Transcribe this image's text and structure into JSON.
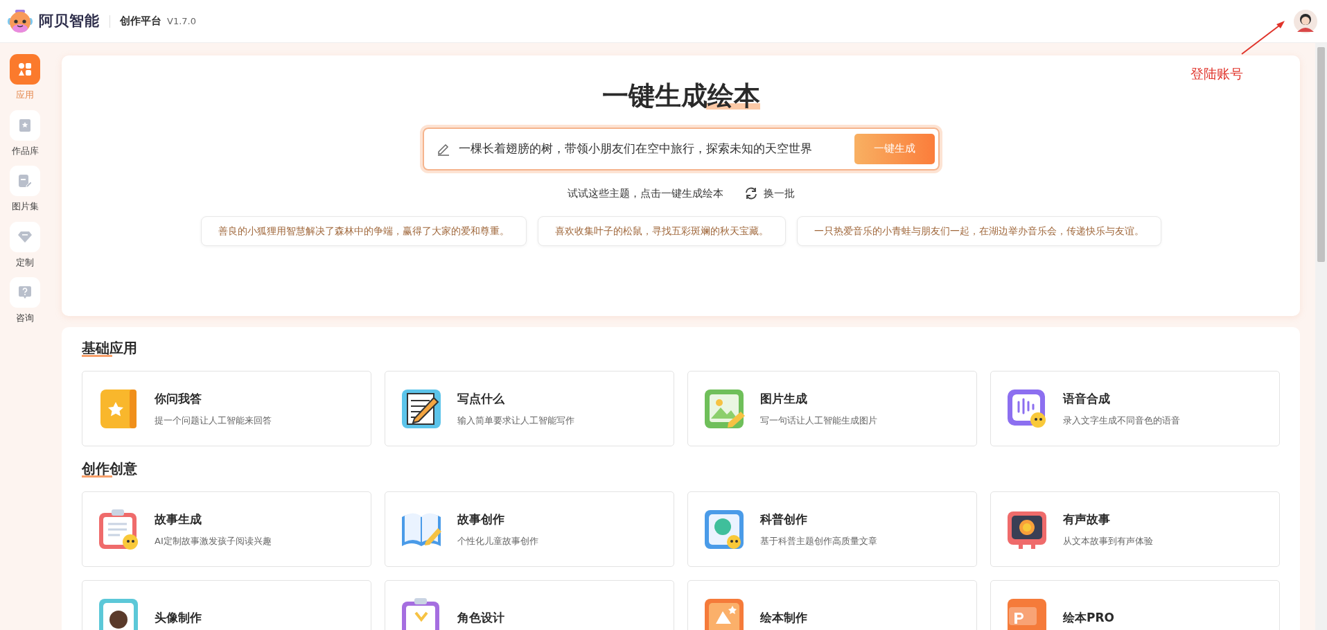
{
  "header": {
    "brand": "阿贝智能",
    "product": "创作平台",
    "version": "V1.7.0"
  },
  "annotation": {
    "text": "登陆账号"
  },
  "sidebar": {
    "items": [
      {
        "label": "应用",
        "selected": true
      },
      {
        "label": "作品库",
        "selected": false
      },
      {
        "label": "图片集",
        "selected": false
      },
      {
        "label": "定制",
        "selected": false
      },
      {
        "label": "咨询",
        "selected": false
      }
    ]
  },
  "hero": {
    "title": "一键生成绘本",
    "input_value": "一棵长着翅膀的树，带领小朋友们在空中旅行，探索未知的天空世界",
    "button": "一键生成",
    "hint": "试试这些主题，点击一键生成绘本",
    "refresh": "换一批",
    "suggestions": [
      "善良的小狐狸用智慧解决了森林中的争端，赢得了大家的爱和尊重。",
      "喜欢收集叶子的松鼠，寻找五彩斑斓的秋天宝藏。",
      "一只热爱音乐的小青蛙与朋友们一起，在湖边举办音乐会，传递快乐与友谊。"
    ]
  },
  "sections": [
    {
      "title": "基础应用",
      "apps": [
        {
          "title": "你问我答",
          "description": "提一个问题让人工智能来回答"
        },
        {
          "title": "写点什么",
          "description": "输入简单要求让人工智能写作"
        },
        {
          "title": "图片生成",
          "description": "写一句话让人工智能生成图片"
        },
        {
          "title": "语音合成",
          "description": "录入文字生成不同音色的语音"
        }
      ]
    },
    {
      "title": "创作创意",
      "apps": [
        {
          "title": "故事生成",
          "description": "AI定制故事激发孩子阅读兴趣"
        },
        {
          "title": "故事创作",
          "description": "个性化儿童故事创作"
        },
        {
          "title": "科普创作",
          "description": "基于科普主题创作高质量文章"
        },
        {
          "title": "有声故事",
          "description": "从文本故事到有声体验"
        },
        {
          "title": "头像制作"
        },
        {
          "title": "角色设计"
        },
        {
          "title": "绘本制作"
        },
        {
          "title": "绘本PRO"
        }
      ]
    }
  ]
}
